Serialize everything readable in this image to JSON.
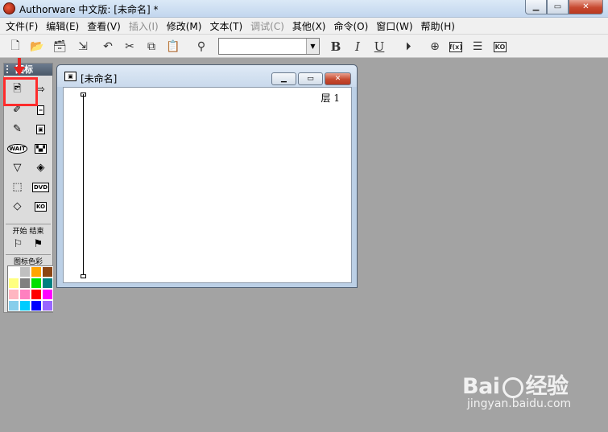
{
  "window": {
    "title": "Authorware 中文版: [未命名] *"
  },
  "menu": [
    {
      "label": "文件(F)",
      "disabled": false
    },
    {
      "label": "编辑(E)",
      "disabled": false
    },
    {
      "label": "查看(V)",
      "disabled": false
    },
    {
      "label": "插入(I)",
      "disabled": true
    },
    {
      "label": "修改(M)",
      "disabled": false
    },
    {
      "label": "文本(T)",
      "disabled": false
    },
    {
      "label": "调试(C)",
      "disabled": true
    },
    {
      "label": "其他(X)",
      "disabled": false
    },
    {
      "label": "命令(O)",
      "disabled": false
    },
    {
      "label": "窗口(W)",
      "disabled": false
    },
    {
      "label": "帮助(H)",
      "disabled": false
    }
  ],
  "toolbar": {
    "bold": "B",
    "italic": "I",
    "underline": "U",
    "style_value": "",
    "functions_label": "f(x)",
    "ko_label": "KO"
  },
  "palette": {
    "title": "图标",
    "start_label": "开始",
    "end_label": "结束",
    "color_label": "图标色彩",
    "wait_label": "WAIT",
    "dvd_label": "DVD",
    "ko_label": "KO",
    "swatches": [
      "#ffffff",
      "#c0c0c0",
      "#ffa500",
      "#8b4513",
      "#ffff80",
      "#808080",
      "#00e000",
      "#008080",
      "#ffb6c1",
      "#ff80c0",
      "#ff0000",
      "#ff00ff",
      "#87ceeb",
      "#00ccff",
      "#0000ff",
      "#9966ff"
    ]
  },
  "design_window": {
    "title": "[未命名]",
    "layer_label": "层 1"
  },
  "watermark": {
    "logo": "Bai",
    "logo_suffix": "经验",
    "url": "jingyan.baidu.com"
  }
}
